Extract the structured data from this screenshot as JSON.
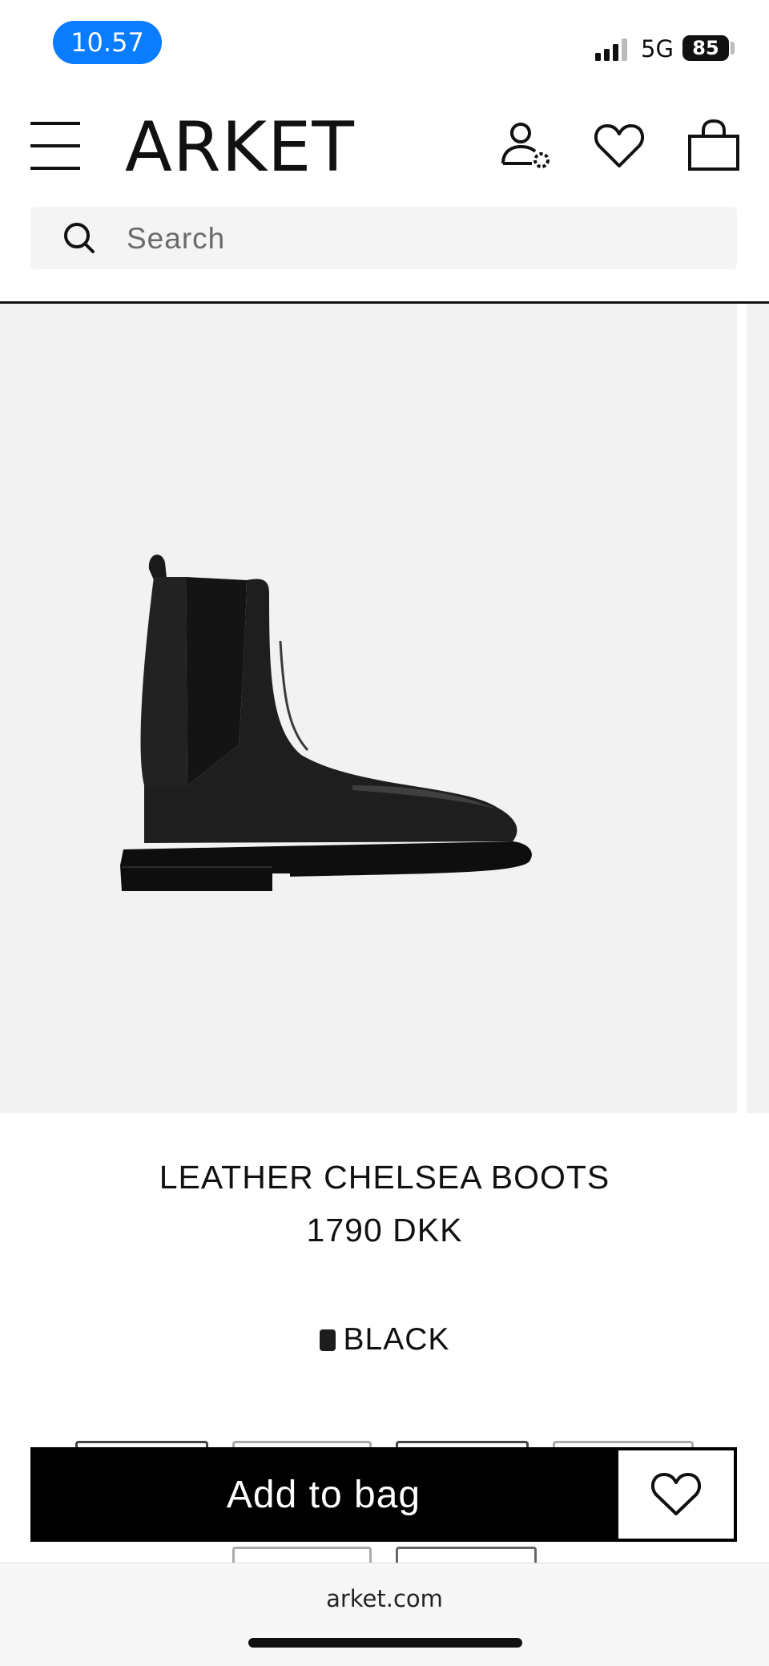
{
  "status_bar": {
    "time": "10.57",
    "network": "5G",
    "battery": "85"
  },
  "header": {
    "logo": "ARKET",
    "icons": [
      "menu-icon",
      "account-icon",
      "heart-icon",
      "bag-icon"
    ]
  },
  "search": {
    "placeholder": "Search"
  },
  "product": {
    "name": "LEATHER CHELSEA BOOTS",
    "price": "1790 DKK",
    "color": "BLACK",
    "swatch_color": "#1d1d1d",
    "image": "black-leather-chelsea-boot"
  },
  "cta": {
    "add_to_bag_label": "Add to bag"
  },
  "browser": {
    "url": "arket.com"
  },
  "colors": {
    "time_pill": "#0a7cff",
    "image_background": "#f2f2f2",
    "cta_background": "#000000"
  }
}
